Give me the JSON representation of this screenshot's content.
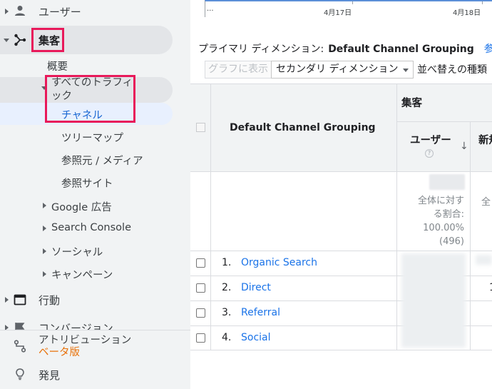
{
  "sidebar": {
    "users_label": "ユーザー",
    "acquisition_label": "集客",
    "overview_label": "概要",
    "all_traffic_label": "すべてのトラフィ\nック",
    "all_traffic_line1": "すべてのトラフィ",
    "all_traffic_line2": "ック",
    "channels_label": "チャネル",
    "treemap_label": "ツリーマップ",
    "source_medium_label": "参照元 / メディア",
    "referrals_label": "参照サイト",
    "google_ads_label": "Google 広告",
    "search_console_label": "Search Console",
    "social_label": "ソーシャル",
    "campaigns_label": "キャンペーン",
    "behavior_label": "行動",
    "conversions_label": "コンバージョン",
    "attribution_label": "アトリビューション",
    "beta_label": "ベータ版",
    "discover_label": "発見"
  },
  "chart": {
    "dots": "...",
    "tick1": "4月17日",
    "tick2": "4月18日"
  },
  "dimension_bar": {
    "label": "プライマリ ディメンション:",
    "value": "Default Channel Grouping",
    "link": "参照元/"
  },
  "toolbar": {
    "graph_button": "グラフに表示",
    "secondary_dimension": "セカンダリ ディメンション",
    "sort_type": "並べ替えの種類"
  },
  "table": {
    "dimension_header": "Default Channel Grouping",
    "group_header": "集客",
    "users_header": "ユーザー",
    "new_users_header_fragment": "新規",
    "help_glyph": "?",
    "sort_glyph": "↓",
    "summary_users": [
      "全体に対す",
      "る割合:",
      "100.00%",
      "(496)"
    ],
    "summary_new_fragment": "全",
    "rows": [
      {
        "num": "1.",
        "name": "Organic Search",
        "frag": ""
      },
      {
        "num": "2.",
        "name": "Direct",
        "frag": "1"
      },
      {
        "num": "3.",
        "name": "Referral",
        "frag": ""
      },
      {
        "num": "4.",
        "name": "Social",
        "frag": ""
      }
    ]
  },
  "colors": {
    "highlight": "#e8195a",
    "link": "#1a73e8",
    "beta": "#e8710a",
    "sidebar_bg": "#f1f3f4",
    "active_bg": "#e8f0fe"
  }
}
